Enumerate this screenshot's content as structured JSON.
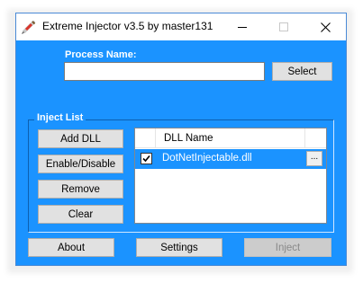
{
  "window": {
    "title": "Extreme Injector v3.5 by master131",
    "icon": "syringe-icon",
    "controls": [
      "minimize-icon",
      "maximize-icon",
      "close-icon"
    ]
  },
  "process": {
    "label": "Process Name:",
    "value": "",
    "select_label": "Select"
  },
  "inject_list": {
    "group_label": "Inject List",
    "buttons": {
      "add": "Add DLL",
      "enable_disable": "Enable/Disable",
      "remove": "Remove",
      "clear": "Clear"
    },
    "columns": [
      "",
      "DLL Name",
      ""
    ],
    "rows": [
      {
        "checked": true,
        "name": "DotNetInjectable.dll",
        "action": "..."
      }
    ]
  },
  "footer": {
    "about": "About",
    "settings": "Settings",
    "inject": "Inject",
    "inject_enabled": false
  },
  "colors": {
    "background": "#1b93ff",
    "selection": "#1b93ff",
    "label_text": "#ffffff"
  }
}
